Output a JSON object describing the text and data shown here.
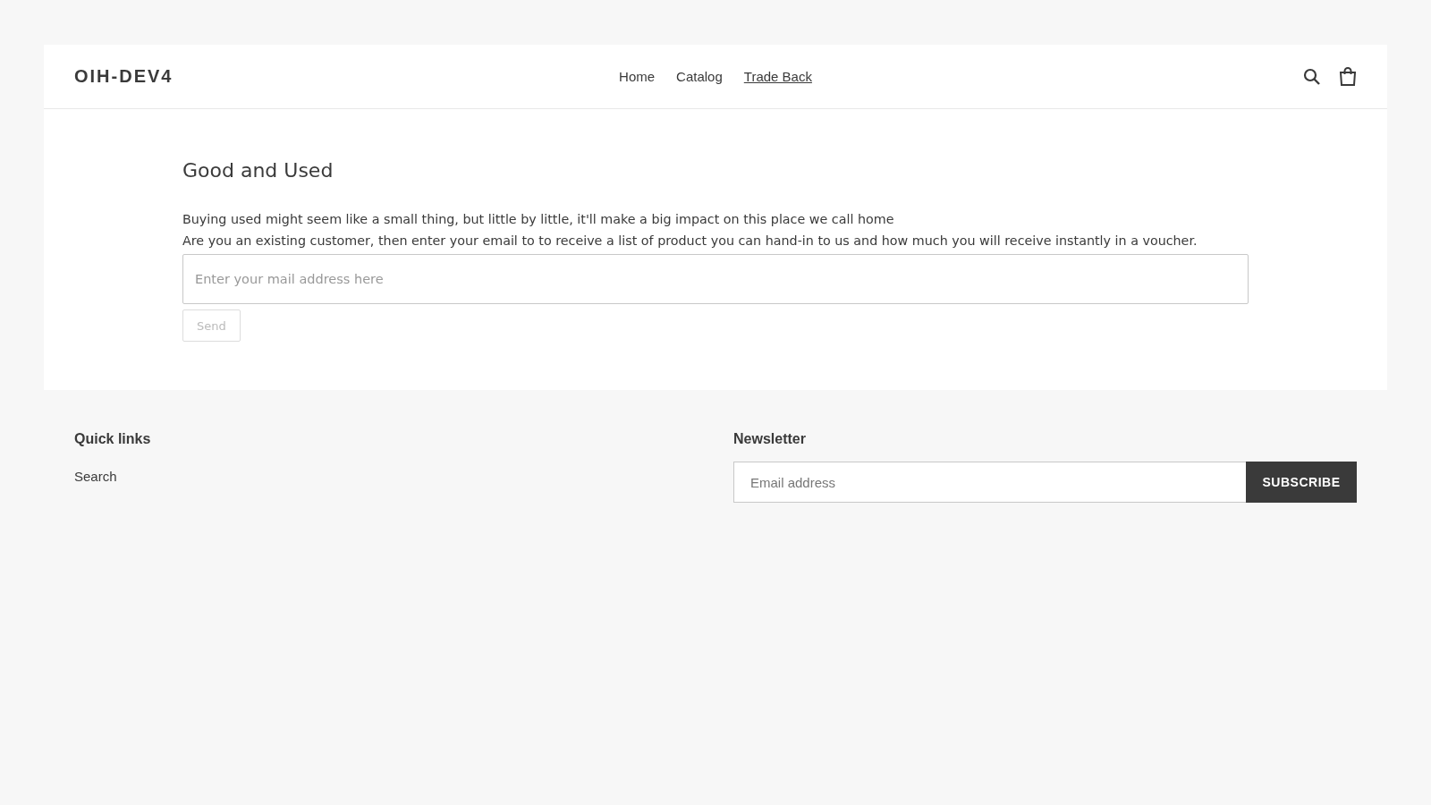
{
  "header": {
    "logo": "OIH-DEV4",
    "nav": [
      {
        "label": "Home",
        "selected": false
      },
      {
        "label": "Catalog",
        "selected": false
      },
      {
        "label": "Trade Back",
        "selected": true
      }
    ]
  },
  "main": {
    "title": "Good and Used",
    "paragraphs": [
      "Buying used might seem like a small thing, but little by little, it'll make a big impact on this place we call home",
      "Are you an existing customer, then enter your email to to receive a list of product you can hand-in to us and how much you will receive instantly in a voucher."
    ],
    "email_field": {
      "placeholder": "Enter your mail address here"
    },
    "send_button": {
      "label": "Send",
      "disabled": true
    }
  },
  "footer": {
    "quick_links": {
      "title": "Quick links",
      "links": [
        "Search"
      ]
    },
    "newsletter": {
      "title": "Newsletter",
      "email_field": {
        "placeholder": "Email address"
      },
      "button": "SUBSCRIBE"
    }
  }
}
